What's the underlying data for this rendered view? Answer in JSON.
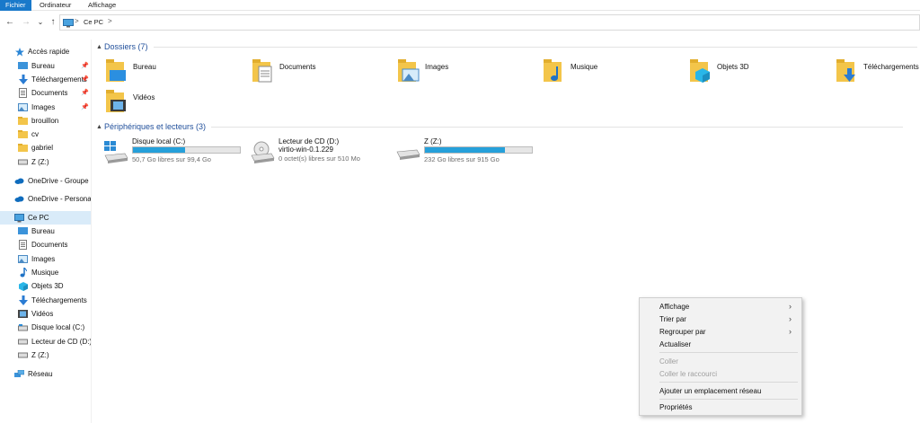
{
  "ribbon": {
    "tabs": [
      {
        "label": "Fichier"
      },
      {
        "label": "Ordinateur"
      },
      {
        "label": "Affichage"
      }
    ]
  },
  "address": {
    "separator": ">",
    "path": "Ce PC",
    "dropdown": "⌄"
  },
  "nav": {
    "back": "←",
    "forward": "→",
    "recent": "⌄",
    "up": "↑"
  },
  "sidebar": {
    "items": [
      {
        "label": "Accès rapide",
        "icon": "star-icon"
      },
      {
        "label": "Bureau",
        "icon": "desktop-icon",
        "pinned": true
      },
      {
        "label": "Téléchargements",
        "icon": "download-icon",
        "pinned": true
      },
      {
        "label": "Documents",
        "icon": "documents-icon",
        "pinned": true
      },
      {
        "label": "Images",
        "icon": "images-icon",
        "pinned": true
      },
      {
        "label": "brouillon",
        "icon": "folder-icon"
      },
      {
        "label": "cv",
        "icon": "folder-icon"
      },
      {
        "label": "gabriel",
        "icon": "folder-icon"
      },
      {
        "label": "Z (Z:)",
        "icon": "drive-icon"
      },
      {
        "label": "OneDrive - Groupe IG",
        "icon": "cloud-icon"
      },
      {
        "label": "OneDrive - Personal",
        "icon": "cloud-icon"
      },
      {
        "label": "Ce PC",
        "icon": "pc-icon"
      },
      {
        "label": "Bureau",
        "icon": "desktop-icon"
      },
      {
        "label": "Documents",
        "icon": "documents-icon"
      },
      {
        "label": "Images",
        "icon": "images-icon"
      },
      {
        "label": "Musique",
        "icon": "music-icon"
      },
      {
        "label": "Objets 3D",
        "icon": "objects3d-icon"
      },
      {
        "label": "Téléchargements",
        "icon": "download-icon"
      },
      {
        "label": "Vidéos",
        "icon": "video-icon"
      },
      {
        "label": "Disque local (C:)",
        "icon": "drive-icon"
      },
      {
        "label": "Lecteur de CD (D:) v",
        "icon": "drive-icon"
      },
      {
        "label": "Z (Z:)",
        "icon": "drive-icon"
      },
      {
        "label": "Réseau",
        "icon": "network-icon"
      }
    ]
  },
  "folders_section": {
    "title": "Dossiers (7)",
    "items": [
      {
        "label": "Bureau"
      },
      {
        "label": "Documents"
      },
      {
        "label": "Images"
      },
      {
        "label": "Musique"
      },
      {
        "label": "Objets 3D"
      },
      {
        "label": "Téléchargements"
      },
      {
        "label": "Vidéos"
      }
    ]
  },
  "drives_section": {
    "title": "Périphériques et lecteurs (3)",
    "items": [
      {
        "name": "Disque local (C:)",
        "info": "50,7 Go libres sur 99,4 Go",
        "used_fraction": 0.49
      },
      {
        "name": "Lecteur de CD (D:)",
        "sub": "virtio-win-0.1.229",
        "info": "0 octet(s) libres sur 510 Mo"
      },
      {
        "name": "Z (Z:)",
        "info": "232 Go libres sur 915 Go",
        "used_fraction": 0.75
      }
    ]
  },
  "context_menu": {
    "items": [
      {
        "label": "Affichage",
        "submenu": true
      },
      {
        "label": "Trier par",
        "submenu": true
      },
      {
        "label": "Regrouper par",
        "submenu": true
      },
      {
        "label": "Actualiser"
      },
      {
        "label": "Coller",
        "disabled": true
      },
      {
        "label": "Coller le raccourci",
        "disabled": true
      },
      {
        "label": "Ajouter un emplacement réseau"
      },
      {
        "label": "Propriétés"
      }
    ],
    "arrow": "›"
  },
  "colors": {
    "accent": "#1979ca",
    "folder": "#f3c54a",
    "bar_fill": "#26a0da",
    "selection": "#d9ebf9"
  }
}
